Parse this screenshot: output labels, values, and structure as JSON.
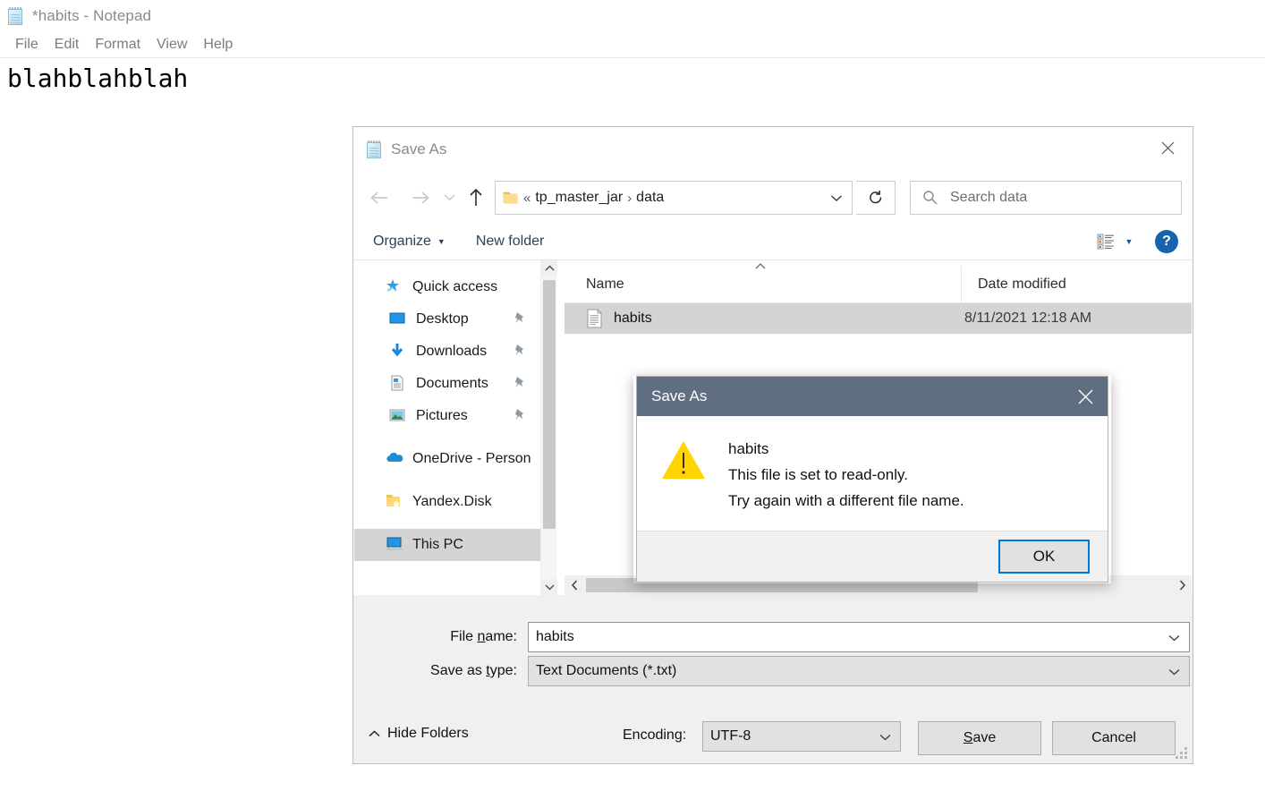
{
  "notepad": {
    "title": "*habits - Notepad",
    "icon": "notepad-icon",
    "menu": [
      "File",
      "Edit",
      "Format",
      "View",
      "Help"
    ],
    "document_text": "blahblahblah"
  },
  "save_dialog": {
    "title": "Save As",
    "icon": "notepad-icon",
    "close_icon": "close-icon",
    "nav": {
      "back_icon": "arrow-left-icon",
      "forward_icon": "arrow-right-icon",
      "recent_icon": "chevron-down-icon",
      "up_icon": "arrow-up-icon",
      "folder_icon": "folder-icon",
      "breadcrumb_prefix": "«",
      "breadcrumbs": [
        "tp_master_jar",
        "data"
      ],
      "breadcrumb_separator": "›",
      "address_chevron_icon": "chevron-down-icon",
      "refresh_icon": "refresh-icon"
    },
    "search": {
      "icon": "search-icon",
      "placeholder": "Search data",
      "value": ""
    },
    "command_bar": {
      "organize_label": "Organize",
      "organize_caret_icon": "caret-down-icon",
      "new_folder_label": "New folder",
      "view_layout_icon": "view-details-icon",
      "view_caret_icon": "caret-down-icon",
      "help_label": "?",
      "help_icon": "help-icon"
    },
    "nav_pane": {
      "items": [
        {
          "label": "Quick access",
          "icon": "star-pin-icon",
          "pinned": false,
          "group": true,
          "selected": false
        },
        {
          "label": "Desktop",
          "icon": "desktop-icon",
          "pinned": true,
          "group": false,
          "selected": false
        },
        {
          "label": "Downloads",
          "icon": "download-icon",
          "pinned": true,
          "group": false,
          "selected": false
        },
        {
          "label": "Documents",
          "icon": "documents-icon",
          "pinned": true,
          "group": false,
          "selected": false
        },
        {
          "label": "Pictures",
          "icon": "pictures-icon",
          "pinned": true,
          "group": false,
          "selected": false
        },
        {
          "label": "OneDrive - Person",
          "icon": "onedrive-cloud-icon",
          "pinned": false,
          "group": true,
          "selected": false
        },
        {
          "label": "Yandex.Disk",
          "icon": "yandex-folder-icon",
          "pinned": false,
          "group": true,
          "selected": false
        },
        {
          "label": "This PC",
          "icon": "this-pc-icon",
          "pinned": false,
          "group": true,
          "selected": true
        }
      ],
      "scroll_up_icon": "chevron-up-icon",
      "scroll_down_icon": "chevron-down-icon"
    },
    "file_list": {
      "columns": [
        "Name",
        "Date modified"
      ],
      "sort_indicator_icon": "sort-ascending-icon",
      "rows": [
        {
          "name": "habits",
          "date_modified": "8/11/2021 12:18 AM",
          "icon": "text-file-icon",
          "selected": true
        }
      ],
      "hscroll_left_icon": "chevron-left-icon",
      "hscroll_right_icon": "chevron-right-icon"
    },
    "form": {
      "filename_label_pre": "File ",
      "filename_label_key": "n",
      "filename_label_post": "ame:",
      "filename_value": "habits",
      "filename_caret_icon": "chevron-down-icon",
      "filetype_label_pre": "Save as ",
      "filetype_label_key": "t",
      "filetype_label_post": "ype:",
      "filetype_value": "Text Documents (*.txt)",
      "filetype_caret_icon": "chevron-down-icon",
      "hide_folders_label": "Hide Folders",
      "hide_folders_icon": "chevron-up-icon",
      "encoding_label": "Encoding:",
      "encoding_value": "UTF-8",
      "encoding_caret_icon": "chevron-down-icon",
      "save_label_pre": "",
      "save_label_key": "S",
      "save_label_post": "ave",
      "cancel_label": "Cancel",
      "resize_grip_icon": "resize-grip-icon"
    }
  },
  "modal": {
    "title": "Save As",
    "close_icon": "close-icon",
    "warning_icon": "warning-triangle-icon",
    "lines": [
      "habits",
      "This file is set to read-only.",
      "Try again with a different file name."
    ],
    "ok_label": "OK"
  },
  "colors": {
    "modal_titlebar": "#5f6e81",
    "focus_border": "#0078d7",
    "help_blue": "#1564ad",
    "warning_yellow": "#ffd400",
    "selection_gray": "#d4d4d4",
    "dialog_face": "#f0f0f0"
  }
}
